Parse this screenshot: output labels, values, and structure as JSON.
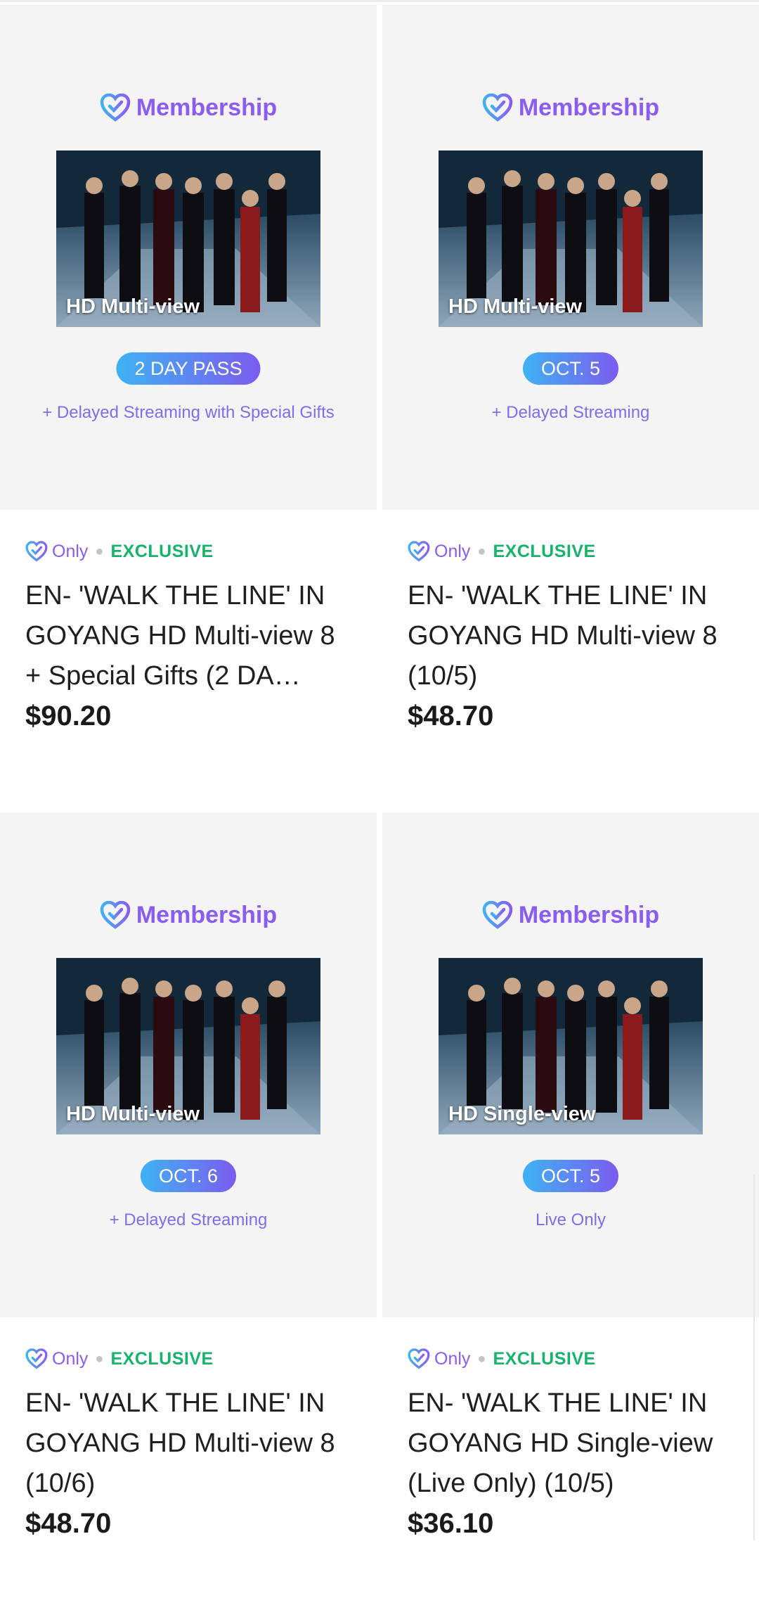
{
  "products": [
    {
      "brand_label": "Membership",
      "photo_label": "HD Multi-view",
      "pill": "2 DAY PASS",
      "subtitle": "+ Delayed Streaming with Special Gifts",
      "only_label": "Only",
      "exclusive_label": "EXCLUSIVE",
      "title": "EN- 'WALK THE LINE' IN GOYANG HD Multi-view 8 + Special Gifts (2 DA…",
      "price": "$90.20"
    },
    {
      "brand_label": "Membership",
      "photo_label": "HD Multi-view",
      "pill": "OCT. 5",
      "subtitle": "+ Delayed Streaming",
      "only_label": "Only",
      "exclusive_label": "EXCLUSIVE",
      "title": "EN- 'WALK THE LINE' IN GOYANG HD Multi-view 8 (10/5)",
      "price": "$48.70"
    },
    {
      "brand_label": "Membership",
      "photo_label": "HD Multi-view",
      "pill": "OCT. 6",
      "subtitle": "+ Delayed Streaming",
      "only_label": "Only",
      "exclusive_label": "EXCLUSIVE",
      "title": "EN- 'WALK THE LINE' IN GOYANG HD Multi-view 8 (10/6)",
      "price": "$48.70"
    },
    {
      "brand_label": "Membership",
      "photo_label": "HD Single-view",
      "pill": "OCT. 5",
      "subtitle": "Live Only",
      "only_label": "Only",
      "exclusive_label": "EXCLUSIVE",
      "title": "EN- 'WALK THE LINE' IN GOYANG HD Single-view (Live Only) (10/5)",
      "price": "$36.10"
    }
  ],
  "colors": {
    "membership_purple": "#8a5cf0",
    "exclusive_green": "#17b36b",
    "pill_gradient_start": "#3fb2f3",
    "pill_gradient_end": "#7b5cf0"
  }
}
